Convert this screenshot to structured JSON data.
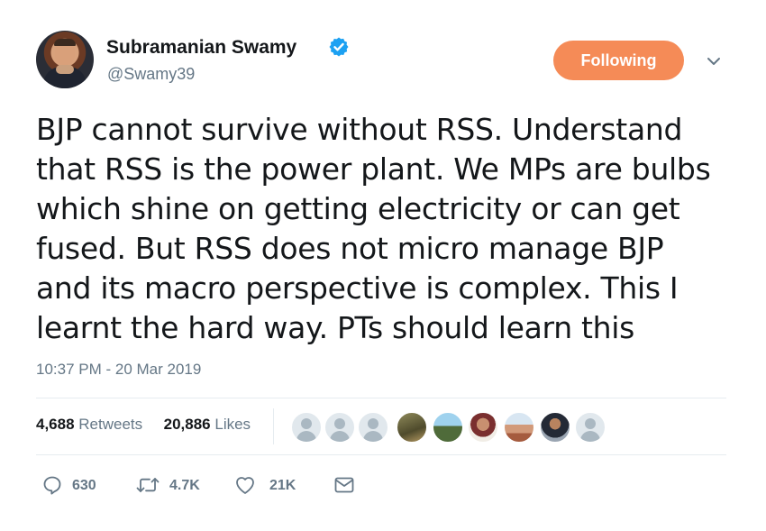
{
  "user": {
    "display_name": "Subramanian Swamy",
    "handle": "@Swamy39",
    "verified": true
  },
  "follow_button": {
    "label": "Following",
    "color": "#f58b57"
  },
  "tweet": {
    "lines": [
      "BJP cannot survive without RSS. Understand",
      "that RSS is the power plant. We MPs are bulbs",
      "which shine on getting electricity or can get",
      "fused. But RSS does not micro manage BJP",
      "and its macro perspective is complex. This I",
      "learnt the hard way. PTs should learn this"
    ],
    "timestamp": "10:37 PM - 20 Mar 2019"
  },
  "stats": {
    "retweets_count": "4,688",
    "retweets_label": "Retweets",
    "likes_count": "20,886",
    "likes_label": "Likes"
  },
  "likers": [
    {
      "icon": "default-avatar-icon"
    },
    {
      "icon": "default-avatar-icon"
    },
    {
      "icon": "default-avatar-icon"
    },
    {
      "icon": "user-avatar"
    },
    {
      "icon": "user-avatar"
    },
    {
      "icon": "user-avatar"
    },
    {
      "icon": "user-avatar"
    },
    {
      "icon": "user-avatar"
    },
    {
      "icon": "default-avatar-icon"
    }
  ],
  "actions": {
    "reply": {
      "icon": "reply-icon",
      "count": "630"
    },
    "retweet": {
      "icon": "retweet-icon",
      "count": "4.7K"
    },
    "like": {
      "icon": "heart-icon",
      "count": "21K"
    },
    "message": {
      "icon": "envelope-icon"
    }
  },
  "colors": {
    "accent": "#1da1f2",
    "muted": "#657786",
    "text": "#14171a",
    "border": "#e6ecf0"
  }
}
